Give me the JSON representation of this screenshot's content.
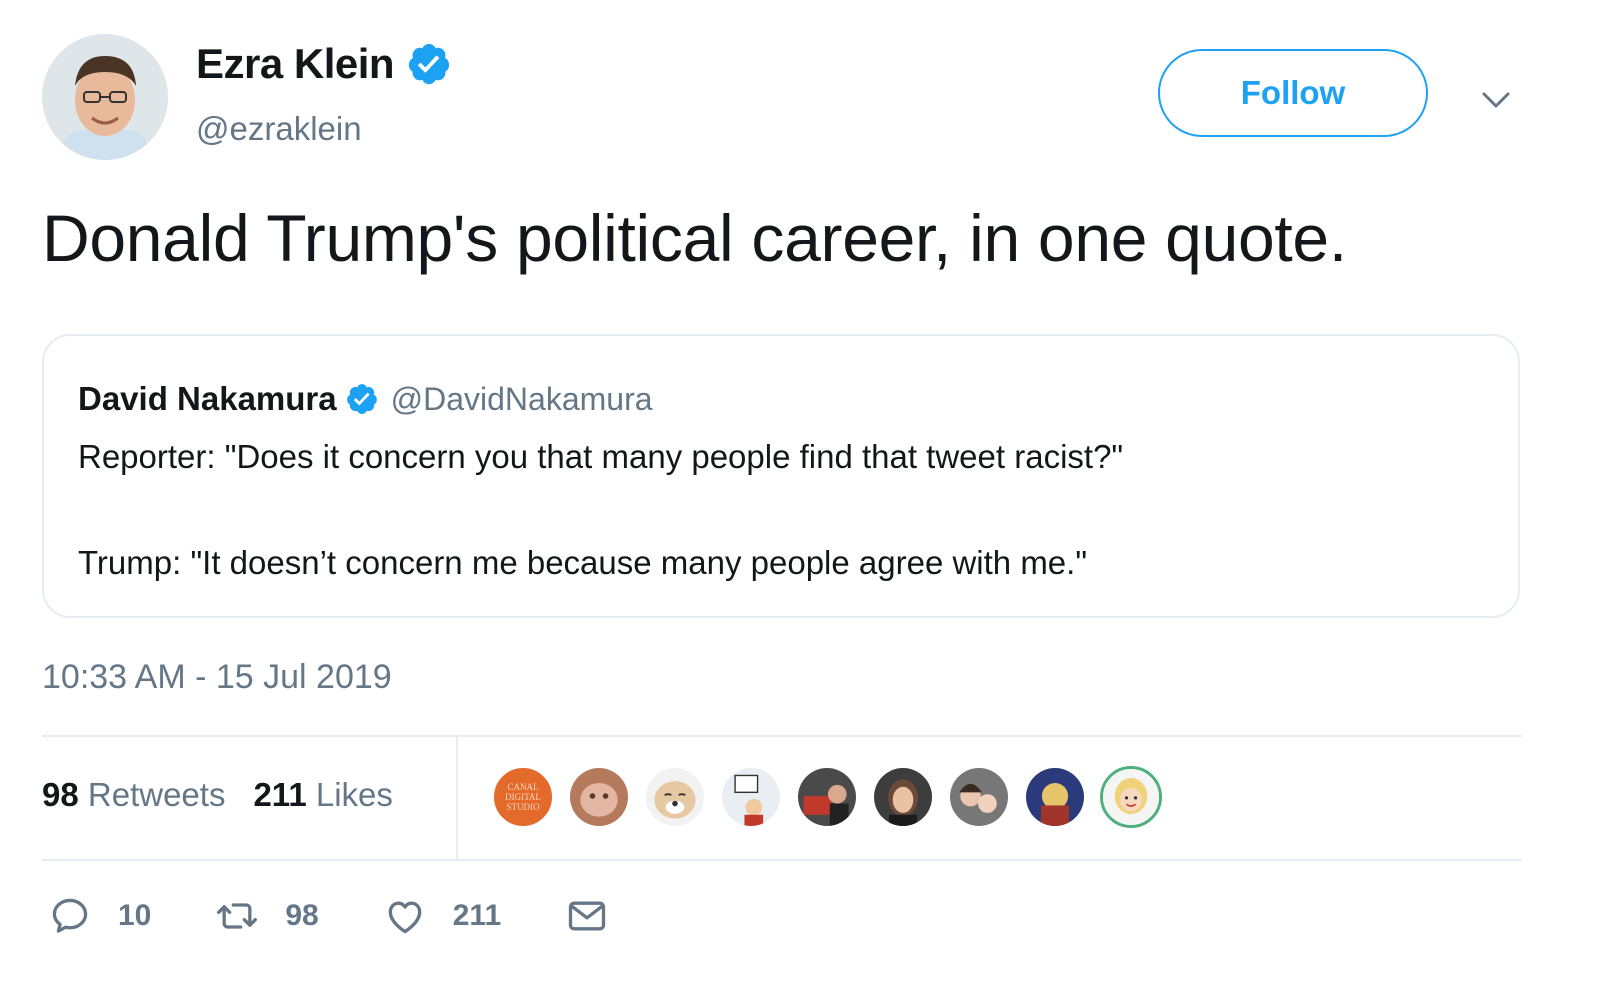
{
  "tweet": {
    "author": {
      "name": "Ezra Klein",
      "handle": "@ezraklein",
      "avatar_icon": "avatar-photo",
      "verified_icon": "verified-badge-icon"
    },
    "follow_label": "Follow",
    "text": "Donald Trump's political career, in one quote.",
    "timestamp": "10:33 AM - 15 Jul 2019"
  },
  "quoted": {
    "name": "David Nakamura",
    "handle": "@DavidNakamura",
    "line1": "Reporter: \"Does it concern you that many people find that tweet racist?\"",
    "line2": "Trump: \"It doesn’t concern me because many people agree with me.\""
  },
  "stats": {
    "retweets_count": "98",
    "retweets_label": "Retweets",
    "likes_count": "211",
    "likes_label": "Likes"
  },
  "liked_by_avatars": [
    {
      "name": "canal-digital-studio-avatar",
      "text": [
        "CANAL",
        "DIGITAL",
        "STUDIO"
      ]
    },
    {
      "name": "liker-avatar-2"
    },
    {
      "name": "liker-avatar-3"
    },
    {
      "name": "liker-avatar-4"
    },
    {
      "name": "liker-avatar-5"
    },
    {
      "name": "liker-avatar-6"
    },
    {
      "name": "liker-avatar-7"
    },
    {
      "name": "liker-avatar-8"
    },
    {
      "name": "liker-avatar-9"
    }
  ],
  "actions": {
    "reply_count": "10",
    "retweet_count": "98",
    "like_count": "211"
  },
  "colors": {
    "accent": "#1da1f2",
    "text": "#14171a",
    "secondary": "#657786",
    "border": "#e6ecf0"
  }
}
